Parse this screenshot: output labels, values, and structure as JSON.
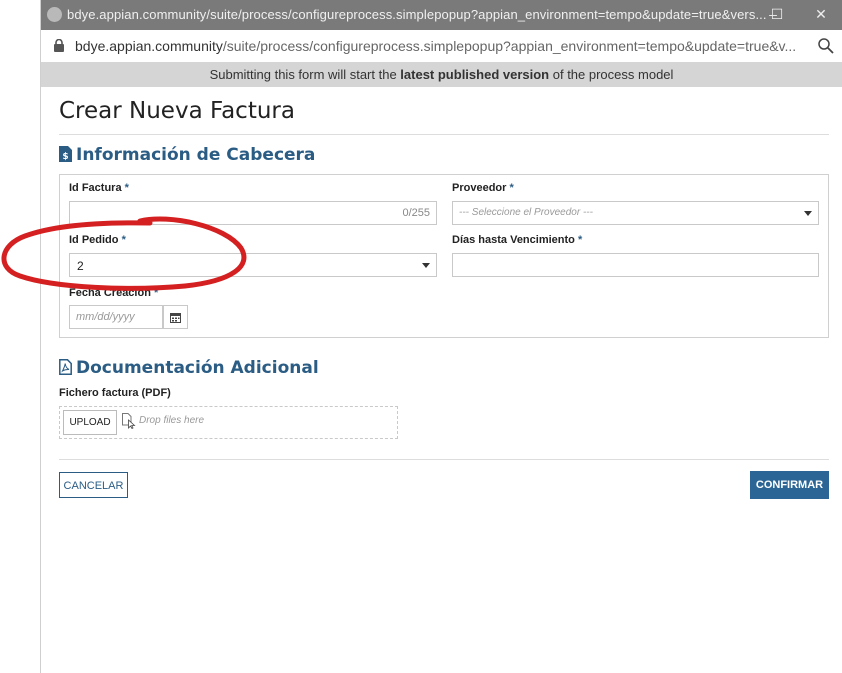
{
  "browser": {
    "window_title": "bdye.appian.community/suite/process/configureprocess.simplepopup?appian_environment=tempo&update=true&vers...",
    "url_host": "bdye.appian.community",
    "url_path": "/suite/process/configureprocess.simplepopup?appian_environment=tempo&update=true&v...",
    "minimize": "–",
    "maximize": "☐",
    "close": "✕"
  },
  "banner": {
    "prefix": "Submitting this form will start the ",
    "bold": "latest published version",
    "suffix": " of the process model"
  },
  "form": {
    "title": "Crear Nueva Factura",
    "section_header": {
      "title": "Información de Cabecera",
      "fields": {
        "id_factura": {
          "label": "Id Factura",
          "required": "*",
          "value": "",
          "counter": "0/255"
        },
        "proveedor": {
          "label": "Proveedor",
          "required": "*",
          "placeholder": "--- Seleccione el Proveedor ---"
        },
        "id_pedido": {
          "label": "Id Pedido",
          "required": "*",
          "value": "2"
        },
        "dias_vencimiento": {
          "label": "Días hasta Vencimiento",
          "required": "*",
          "value": ""
        },
        "fecha_creacion": {
          "label": "Fecha Creación",
          "required": "*",
          "placeholder": "mm/dd/yyyy"
        }
      }
    },
    "section_docs": {
      "title": "Documentación Adicional",
      "file_label": "Fichero factura (PDF)",
      "upload_label": "UPLOAD",
      "drop_text": "Drop files here"
    },
    "buttons": {
      "cancel": "CANCELAR",
      "confirm": "CONFIRMAR"
    }
  },
  "colors": {
    "accent": "#2a5c84",
    "confirm_bg": "#2a6596",
    "annotation": "#d42020"
  }
}
